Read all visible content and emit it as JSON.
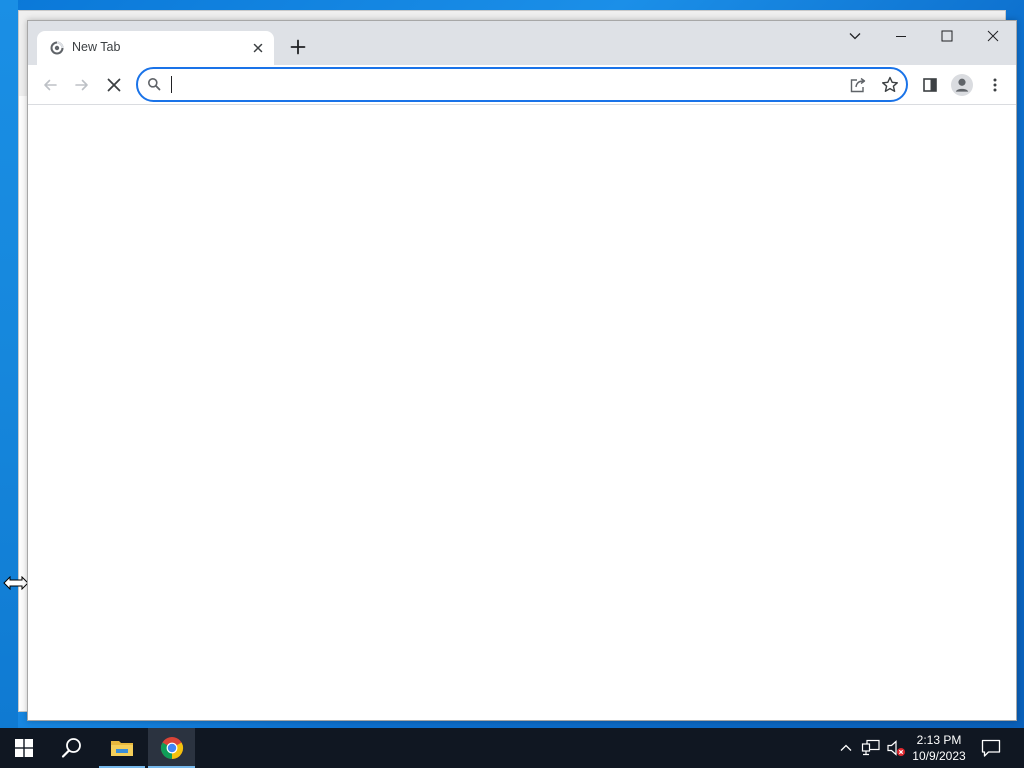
{
  "browser": {
    "tab": {
      "title": "New Tab"
    },
    "omnibox": {
      "value": "",
      "placeholder": ""
    }
  },
  "taskbar": {
    "clock": {
      "time": "2:13 PM",
      "date": "10/9/2023"
    },
    "active_app": "chrome"
  },
  "colors": {
    "tabstrip": "#dee1e6",
    "omnibox_focus": "#1a73e8",
    "taskbar": "#101722",
    "desktop": "#0a78d8"
  },
  "icons": {
    "tab_favicon": "chrome-loading-icon",
    "new_tab": "plus-icon",
    "back": "arrow-left-icon",
    "forward": "arrow-right-icon",
    "stop": "close-x-icon",
    "search": "search-icon",
    "share": "share-icon",
    "bookmark": "star-icon",
    "side_panel": "side-panel-icon",
    "profile": "profile-avatar-icon",
    "menu": "kebab-menu-icon"
  }
}
